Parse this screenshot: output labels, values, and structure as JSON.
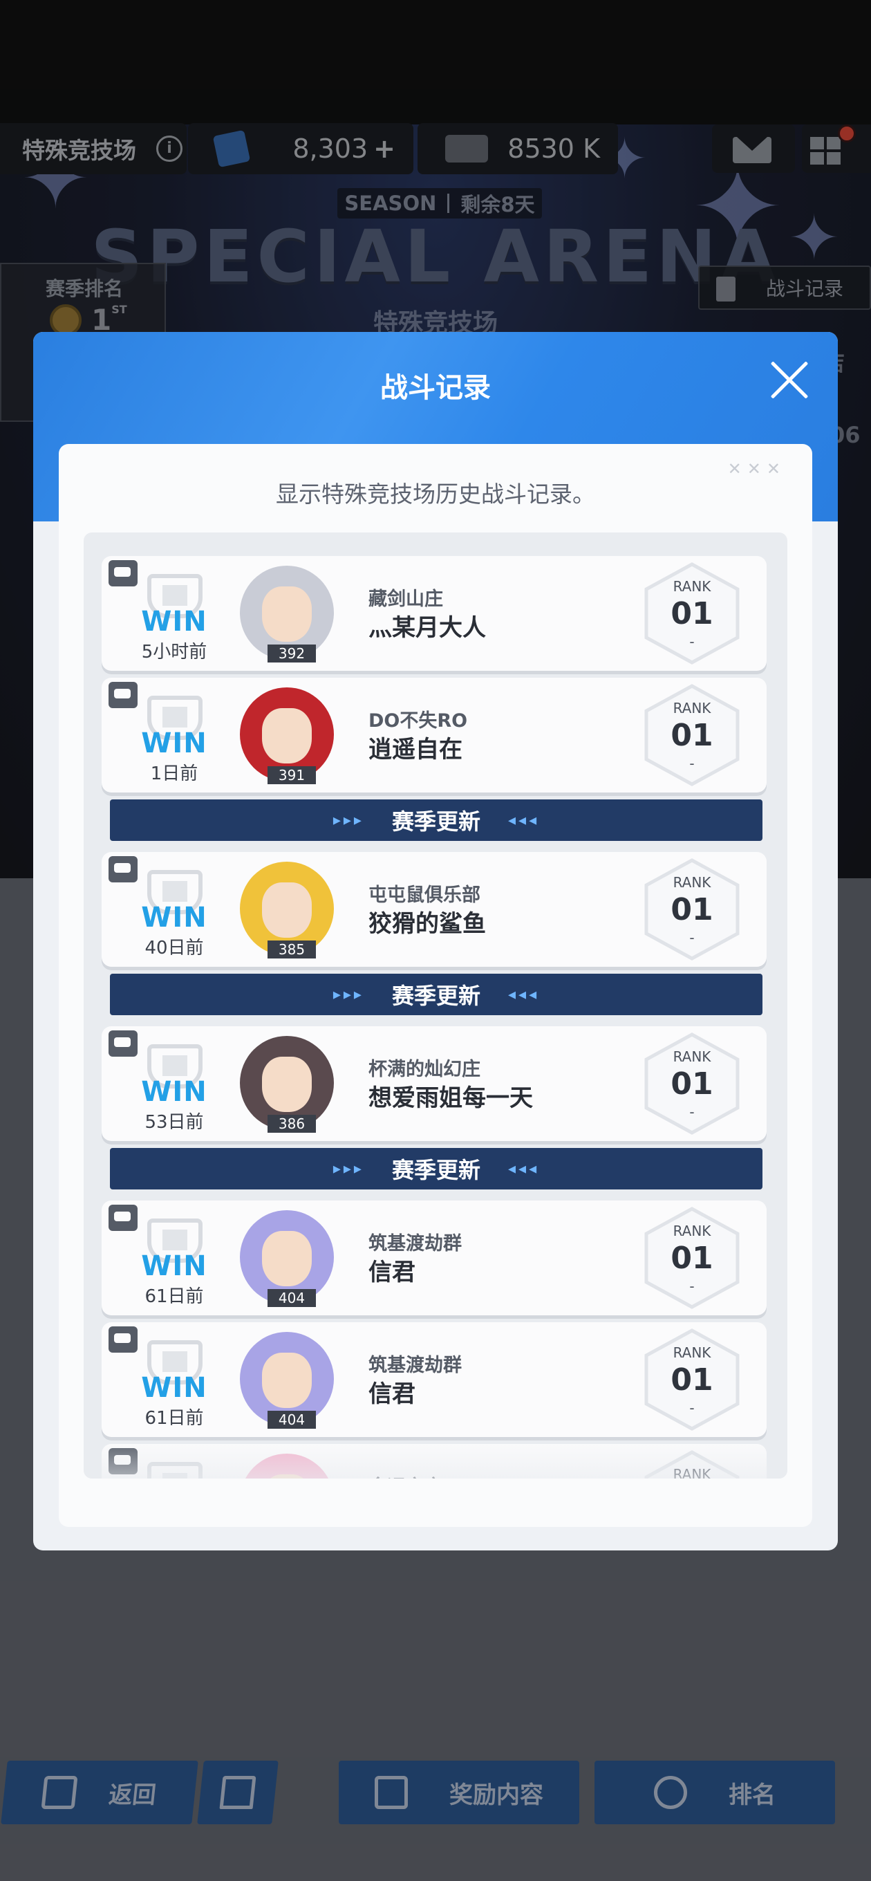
{
  "topbar": {
    "title": "特殊竞技场",
    "info_icon": "info-icon",
    "resource1": {
      "value": "8,303",
      "plus": "+",
      "icon": "crystal-icon",
      "color": "#3a6fb5"
    },
    "resource2": {
      "value": "8530 K",
      "icon": "credit-card-icon",
      "color": "#6b6f78"
    },
    "mail_icon": "mail-icon",
    "menu_icon": "grid-menu-icon"
  },
  "hero": {
    "season_label": "SEASON",
    "season_remaining": "剩余8天",
    "title": "SPECIAL ARENA",
    "subtitle": "特殊竞技场",
    "season_rank_label": "赛季排名",
    "season_rank_value": "1",
    "season_rank_suffix": "ST",
    "record_button": "战斗记录",
    "side_peek_text": "店",
    "side_peek_number": "06"
  },
  "modal": {
    "title": "战斗记录",
    "description": "显示特殊竞技场历史战斗记录。",
    "records": [
      {
        "result": "WIN",
        "time": "5小时前",
        "level": "392",
        "guild": "藏剑山庄",
        "name": "灬某月大人",
        "rank_label": "RANK",
        "rank": "01",
        "rank_delta": "-",
        "avatar_color": "#c9ccd6"
      },
      {
        "result": "WIN",
        "time": "1日前",
        "level": "391",
        "guild": "DO不失RO",
        "name": "逍遥自在",
        "rank_label": "RANK",
        "rank": "01",
        "rank_delta": "-",
        "avatar_color": "#c0262c"
      },
      {
        "result": "WIN",
        "time": "40日前",
        "level": "385",
        "guild": "屯屯鼠俱乐部",
        "name": "狡猾的鲨鱼",
        "rank_label": "RANK",
        "rank": "01",
        "rank_delta": "-",
        "avatar_color": "#f0c23a"
      },
      {
        "result": "WIN",
        "time": "53日前",
        "level": "386",
        "guild": "杯满的灿幻庄",
        "name": "想爱雨姐每一天",
        "rank_label": "RANK",
        "rank": "01",
        "rank_delta": "-",
        "avatar_color": "#5a4a4e"
      },
      {
        "result": "WIN",
        "time": "61日前",
        "level": "404",
        "guild": "筑基渡劫群",
        "name": "信君",
        "rank_label": "RANK",
        "rank": "01",
        "rank_delta": "-",
        "avatar_color": "#a8a4e6"
      },
      {
        "result": "WIN",
        "time": "61日前",
        "level": "404",
        "guild": "筑基渡劫群",
        "name": "信君",
        "rank_label": "RANK",
        "rank": "01",
        "rank_delta": "-",
        "avatar_color": "#a8a4e6"
      },
      {
        "result": "",
        "time": "",
        "level": "",
        "guild": "金运之夜",
        "name": "",
        "rank_label": "RANK",
        "rank": "",
        "rank_delta": "",
        "avatar_color": "#f2b8d0"
      }
    ],
    "season_update_label": "赛季更新"
  },
  "bottom_nav": {
    "back": "返回",
    "home_icon": "home-icon",
    "rewards": "奖励内容",
    "ranking": "排名"
  },
  "colors": {
    "accent_blue": "#2e87ea",
    "win_blue": "#23a0e6",
    "season_bar": "#223b66",
    "nav_blue": "#2f5d98"
  }
}
